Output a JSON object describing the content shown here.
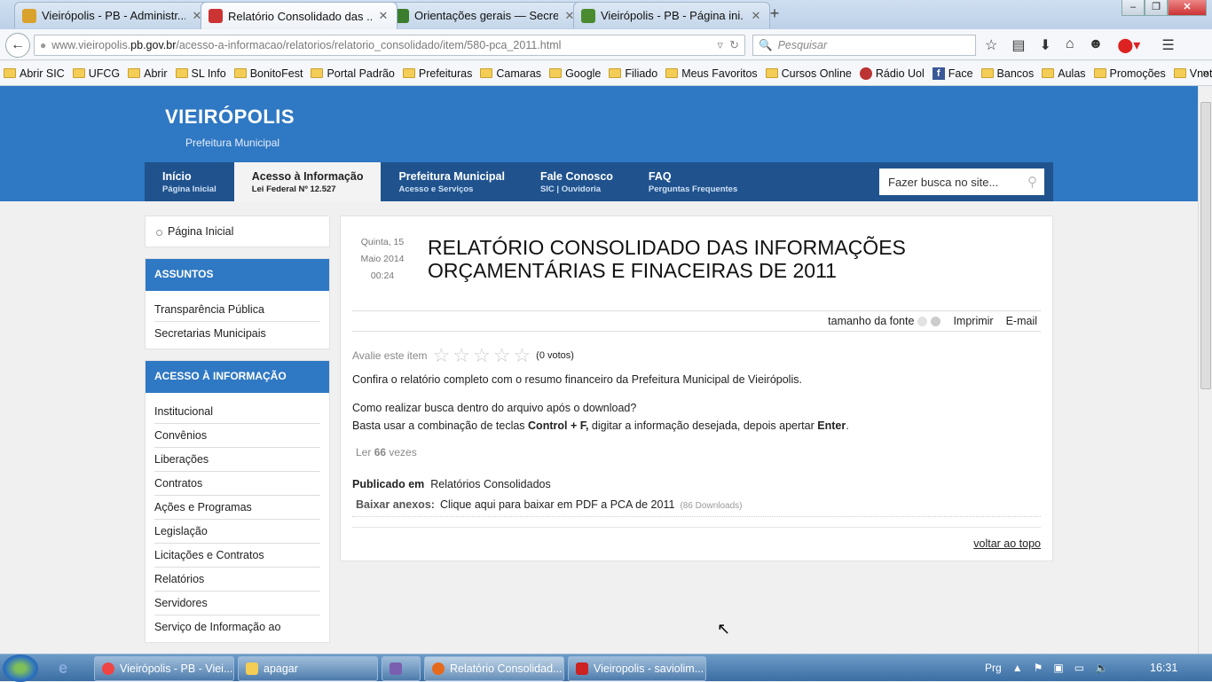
{
  "browser": {
    "tabs": [
      {
        "label": "Vieirópolis - PB - Administr...",
        "icon_color": "#d9a22c"
      },
      {
        "label": "Relatório Consolidado das ...",
        "icon_color": "#c33"
      },
      {
        "label": "Orientações gerais — Secre...",
        "icon_color": "#3a7d2c"
      },
      {
        "label": "Vieirópolis - PB - Página ini...",
        "icon_color": "#4b8b2f"
      }
    ],
    "new_tab": "+",
    "window_controls": [
      "–",
      "❐",
      "✕"
    ],
    "url_domain_before": "www.vieiropolis.",
    "url_domain": "pb.gov.br",
    "url_path": "/acesso-a-informacao/relatorios/relatorio_consolidado/item/580-pca_2011.html",
    "search_placeholder": "Pesquisar",
    "bookmarks": [
      "Abrir SIC",
      "UFCG",
      "Abrir",
      "SL Info",
      "BonitoFest",
      "Portal Padrão",
      "Prefeituras",
      "Camaras",
      "Google",
      "Filiado",
      "Meus Favoritos",
      "Cursos Online",
      "Rádio Uol",
      "Face",
      "Bancos",
      "Aulas",
      "Promoções",
      "Vnoticias"
    ],
    "bookmarks_more": "»"
  },
  "site": {
    "title": "VIEIRÓPOLIS",
    "subtitle": "Prefeitura Municipal",
    "menu": [
      {
        "title": "Início",
        "sub": "Página Inicial"
      },
      {
        "title": "Acesso à Informação",
        "sub": "Lei Federal Nº 12.527"
      },
      {
        "title": "Prefeitura Municipal",
        "sub": "Acesso e Serviços"
      },
      {
        "title": "Fale Conosco",
        "sub": "SIC | Ouvidoria"
      },
      {
        "title": "FAQ",
        "sub": "Perguntas Frequentes"
      }
    ],
    "search_placeholder": "Fazer busca no site..."
  },
  "sidebar": {
    "home": "Página Inicial",
    "assuntos_title": "ASSUNTOS",
    "assuntos": [
      "Transparência Pública",
      "Secretarias Municipais"
    ],
    "acesso_title": "ACESSO À INFORMAÇÃO",
    "acesso": [
      "Institucional",
      "Convênios",
      "Liberações",
      "Contratos",
      "Ações e Programas",
      "Legislação",
      "Licitações e Contratos",
      "Relatórios",
      "Servidores",
      "Serviço de Informação ao"
    ]
  },
  "article": {
    "date_day": "Quinta, 15",
    "date_month": "Maio 2014",
    "date_time": "00:24",
    "title": "RELATÓRIO CONSOLIDADO DAS INFORMAÇÕES ORÇAMENTÁRIAS E FINACEIRAS DE 2011",
    "font_size_label": "tamanho da fonte",
    "print": "Imprimir",
    "email": "E-mail",
    "rate_label": "Avalie este item",
    "votes": "(0 votos)",
    "p1": "Confira o relatório completo com o resumo financeiro da Prefeitura Municipal de Vieirópolis.",
    "p2a": "Como realizar busca dentro do arquivo após o download?",
    "p2b_pre": "Basta usar a combinação de teclas ",
    "p2b_keys": "Control + F,",
    "p2b_mid": " digitar a informação desejada, depois apertar ",
    "p2b_enter": "Enter",
    "p2b_end": ".",
    "hits_pre": "Ler ",
    "hits_count": "66",
    "hits_post": " vezes",
    "published_label": "Publicado em",
    "published_cat": "Relatórios Consolidados",
    "attach_label": "Baixar anexos:",
    "attach_link": "Clique aqui para baixar em PDF a PCA de 2011",
    "attach_downloads": "(86 Downloads)",
    "back_top": "voltar ao topo"
  },
  "taskbar": {
    "items": [
      {
        "label": "Vieirópolis - PB - Viei...",
        "color": "#e44"
      },
      {
        "label": "apagar",
        "color": "#f3cd55"
      },
      {
        "label": "",
        "color": "#7a5fb0"
      },
      {
        "label": "Relatório Consolidad...",
        "color": "#e66a1c"
      },
      {
        "label": "Vieiropolis - saviolim...",
        "color": "#c22"
      }
    ],
    "lang": "Prg",
    "time": "16:31"
  }
}
